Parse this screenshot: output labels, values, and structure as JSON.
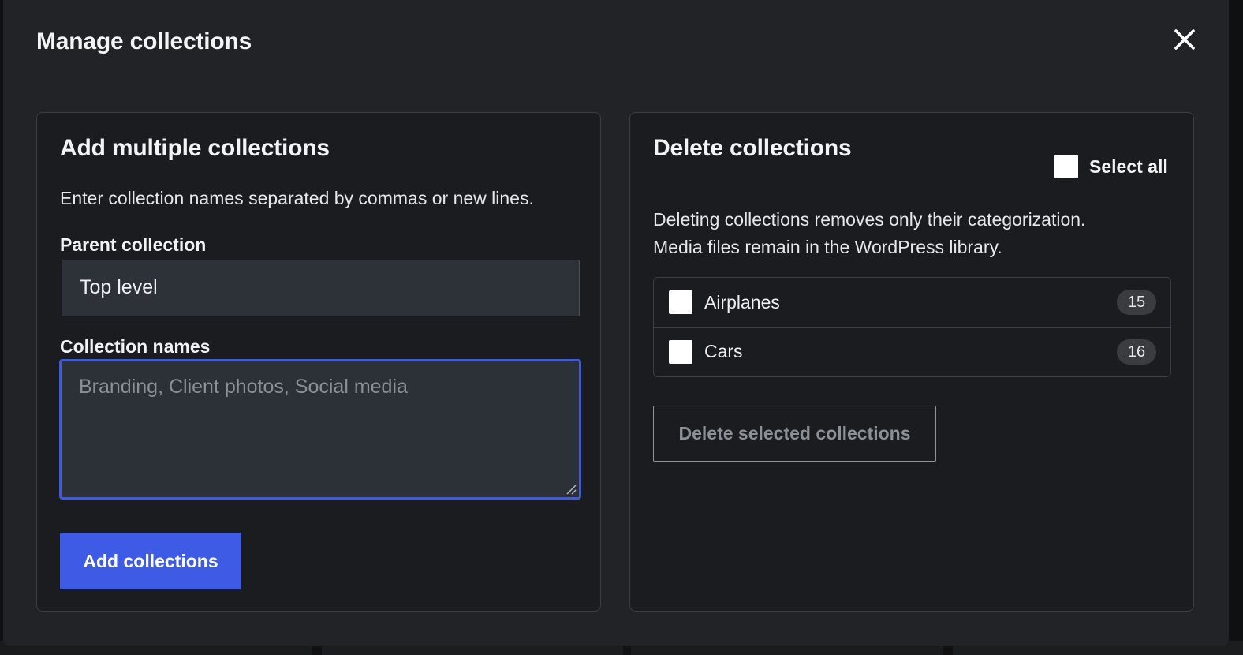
{
  "modal": {
    "title": "Manage collections",
    "close_icon": "close-icon"
  },
  "add_panel": {
    "heading": "Add multiple collections",
    "help": "Enter collection names separated by commas or new lines.",
    "parent_label": "Parent collection",
    "parent_value": "Top level",
    "names_label": "Collection names",
    "names_placeholder": "Branding, Client photos, Social media",
    "names_value": "",
    "submit_label": "Add collections"
  },
  "delete_panel": {
    "heading": "Delete collections",
    "select_all_label": "Select all",
    "desc_line1": "Deleting collections removes only their categorization.",
    "desc_line2": "Media files remain in the WordPress library.",
    "items": [
      {
        "name": "Airplanes",
        "count": "15",
        "checked": false
      },
      {
        "name": "Cars",
        "count": "16",
        "checked": false
      }
    ],
    "delete_label": "Delete selected collections",
    "delete_disabled": true
  },
  "colors": {
    "accent": "#3e5be5",
    "focus_border": "#3e5bdc",
    "modal_bg": "#222326",
    "panel_bg": "#1a1c1f"
  }
}
